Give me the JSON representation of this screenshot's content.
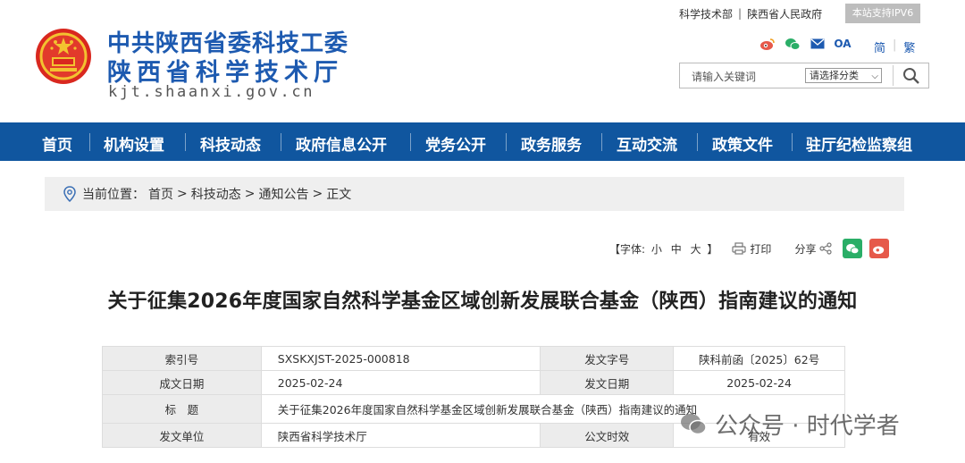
{
  "header": {
    "brand_line1": "中共陕西省委科技工委",
    "brand_line2": "陕西省科学技术厅",
    "domain": "kjt.shaanxi.gov.cn",
    "toplinks": [
      "科学技术部",
      "陕西省人民政府"
    ],
    "ipv6_badge": "本站支持IPV6",
    "lang_simplified": "简",
    "lang_traditional": "繁",
    "social_oa": "OA"
  },
  "search": {
    "placeholder": "请输入关键词",
    "category_select": "请选择分类"
  },
  "nav": [
    "首页",
    "机构设置",
    "科技动态",
    "政府信息公开",
    "党务公开",
    "政务服务",
    "互动交流",
    "政策文件",
    "驻厅纪检监察组"
  ],
  "breadcrumb": {
    "label": "当前位置：",
    "items": [
      "首页",
      ">",
      "科技动态",
      ">",
      "通知公告",
      ">",
      "正文"
    ]
  },
  "tools": {
    "font_label": "【字体:",
    "font_small": "小",
    "font_medium": "中",
    "font_large": "大",
    "font_close": "】",
    "print": "打印",
    "share": "分享"
  },
  "article": {
    "title": "关于征集2026年度国家自然科学基金区域创新发展联合基金（陕西）指南建议的通知"
  },
  "info": {
    "index_label": "索引号",
    "index_value": "SXSKXJST-2025-000818",
    "docno_label": "发文字号",
    "docno_value": "陕科前函〔2025〕62号",
    "date_label": "成文日期",
    "date_value": "2025-02-24",
    "pubdate_label": "发文日期",
    "pubdate_value": "2025-02-24",
    "subject_label": "标　题",
    "subject_value": "关于征集2026年度国家自然科学基金区域创新发展联合基金（陕西）指南建议的通知",
    "issuer_label": "发文单位",
    "issuer_value": "陕西省科学技术厅",
    "validity_label": "公文时效",
    "validity_value": "有效"
  },
  "watermark": {
    "text": "公众号 · 时代学者"
  },
  "colors": {
    "brand_blue": "#1d5ab0",
    "nav_blue": "#10569f",
    "wechat_green": "#2aae67",
    "weibo_red": "#e6594a"
  }
}
